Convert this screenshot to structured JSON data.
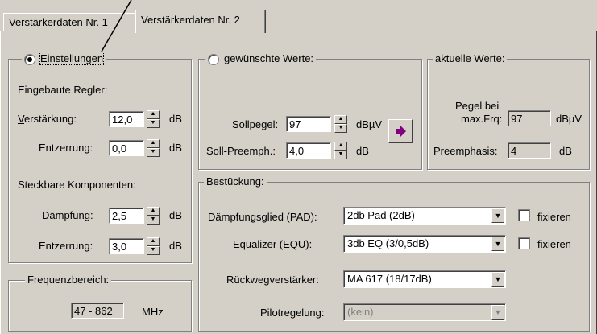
{
  "tabs": {
    "tab1": "Verstärkerdaten Nr. 1",
    "tab2": "Verstärkerdaten Nr. 2"
  },
  "einstellungen": {
    "label": "Einstellungen",
    "eingebaute_title": "Eingebaute Regler:",
    "verstaerkung_label_first": "V",
    "verstaerkung_label_rest": "erstärkung:",
    "verstaerkung_value": "12,0",
    "entzerrung_label": "Entzerrung:",
    "entzerrung_value": "0,0",
    "steckbare_title": "Steckbare Komponenten:",
    "daempfung_label": "Dämpfung:",
    "daempfung_value": "2,5",
    "entzerrung2_label": "Entzerrung:",
    "entzerrung2_value": "3,0",
    "unit_db": "dB"
  },
  "gewuenschte": {
    "label": "gewünschte Werte:",
    "sollpegel_label": "Sollpegel:",
    "sollpegel_value": "97",
    "sollpegel_unit": "dBµV",
    "soll_preemph_label": "Soll-Preemph.:",
    "soll_preemph_value": "4,0",
    "soll_preemph_unit": "dB",
    "apply_icon": "right-arrow-icon"
  },
  "aktuelle": {
    "label": "aktuelle Werte:",
    "pegel_label_line1": "Pegel bei",
    "pegel_label_line2": "max.Frq:",
    "pegel_value": "97",
    "pegel_unit": "dBµV",
    "preemphasis_label": "Preemphasis:",
    "preemphasis_value": "4",
    "preemphasis_unit": "dB"
  },
  "frequenz": {
    "label": "Frequenzbereich:",
    "value": "47 - 862",
    "unit": "MHz"
  },
  "bestueckung": {
    "label": "Bestückung:",
    "pad_label": "Dämpfungsglied (PAD):",
    "pad_value": "2db Pad  (2dB)",
    "equ_label": "Equalizer (EQU):",
    "equ_value": "3db EQ (3/0,5dB)",
    "rueckweg_label": "Rückwegverstärker:",
    "rueckweg_value": "MA 617 (18/17dB)",
    "pilot_label": "Pilotregelung:",
    "pilot_value": "(kein)",
    "fixieren_label": "fixieren"
  },
  "colors": {
    "face": "#d4d0c8",
    "arrow": "#800080"
  }
}
